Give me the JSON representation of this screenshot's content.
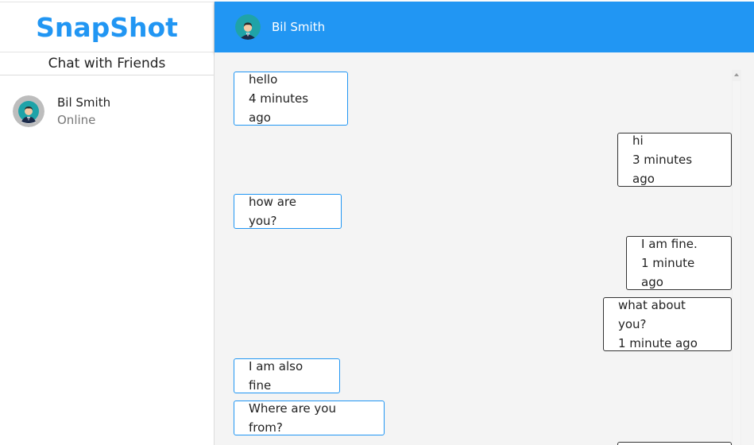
{
  "app": {
    "brand": "SnapShot",
    "subtitle": "Chat with Friends",
    "accent_color": "#2196f3"
  },
  "sidebar": {
    "friends": [
      {
        "name": "Bil Smith",
        "status": "Online",
        "avatar_icon": "user-avatar-icon"
      }
    ]
  },
  "header": {
    "contact_name": "Bil Smith",
    "avatar_icon": "user-avatar-icon"
  },
  "messages": [
    {
      "direction": "incoming",
      "text": "hello",
      "time": "4 minutes ago"
    },
    {
      "direction": "outgoing",
      "text": "hi",
      "time": "3 minutes ago"
    },
    {
      "direction": "incoming",
      "text": "how are you?",
      "time": ""
    },
    {
      "direction": "outgoing",
      "text": "I am fine.",
      "time": "1 minute ago"
    },
    {
      "direction": "outgoing",
      "text": "what about you?",
      "time": "1 minute ago"
    },
    {
      "direction": "incoming",
      "text": "I am also fine",
      "time": ""
    },
    {
      "direction": "incoming",
      "text": "Where are you from?",
      "time": ""
    }
  ]
}
